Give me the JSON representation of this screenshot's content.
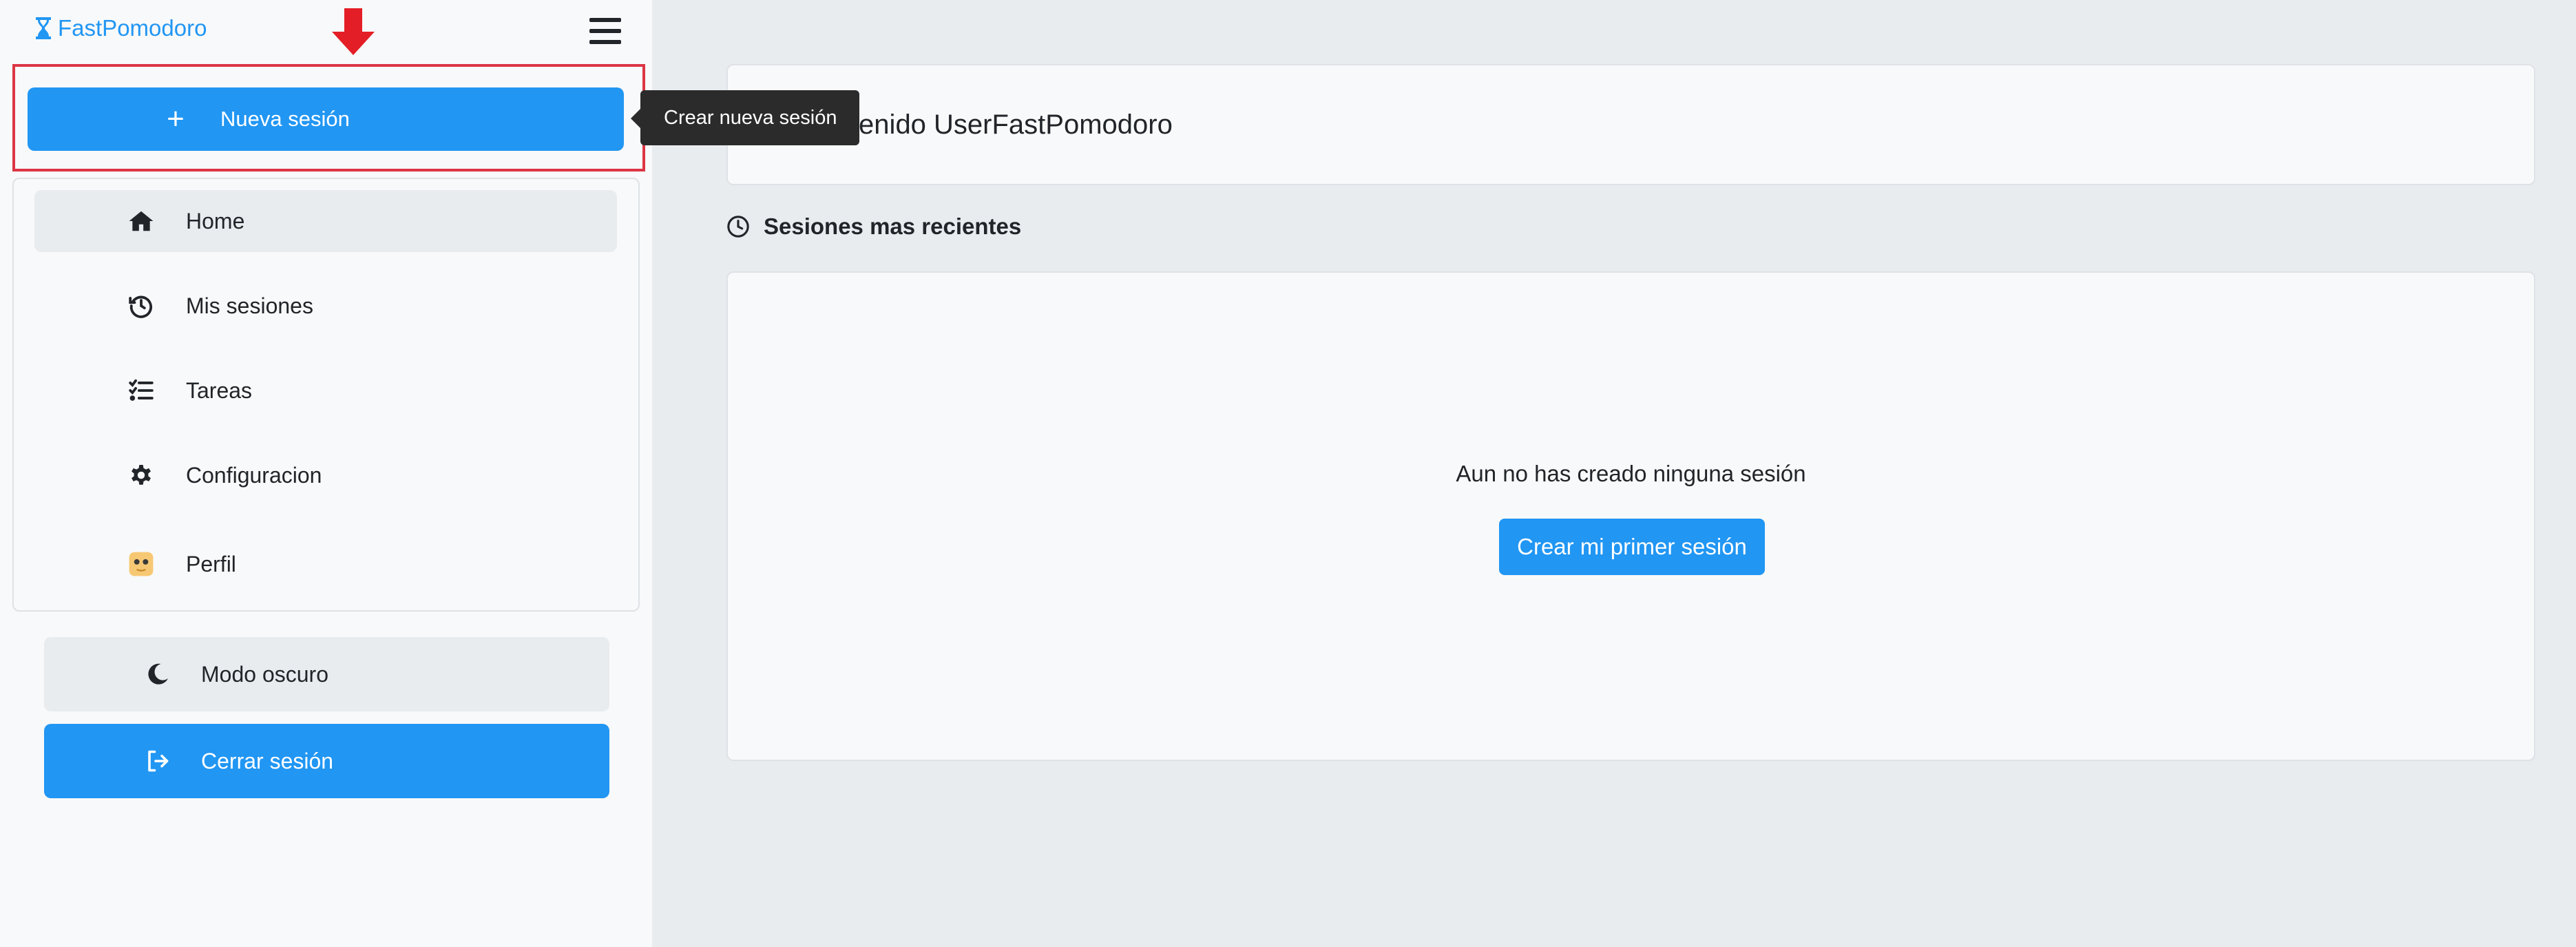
{
  "brand": {
    "name": "FastPomodoro",
    "icon": "hourglass-icon"
  },
  "header": {
    "menu_icon": "hamburger-icon"
  },
  "sidebar": {
    "new_session_label": "Nueva sesión",
    "new_session_tooltip": "Crear nueva sesión",
    "items": [
      {
        "label": "Home",
        "icon": "home-icon",
        "active": true
      },
      {
        "label": "Mis sesiones",
        "icon": "history-icon"
      },
      {
        "label": "Tareas",
        "icon": "task-list-icon"
      },
      {
        "label": "Configuracion",
        "icon": "gear-icon"
      },
      {
        "label": "Perfil",
        "icon": "avatar-icon"
      }
    ],
    "dark_mode_label": "Modo oscuro",
    "logout_label": "Cerrar sesión"
  },
  "main": {
    "welcome_text": "Bienvenido UserFastPomodoro",
    "recent_title": "Sesiones mas recientes",
    "empty_message": "Aun no has creado ninguna sesión",
    "first_session_button": "Crear mi primer sesión"
  },
  "colors": {
    "primary": "#2196f3",
    "annotation_red": "#dc3545",
    "sidebar_bg": "#f8f9fa",
    "page_bg": "#e9ecef"
  }
}
